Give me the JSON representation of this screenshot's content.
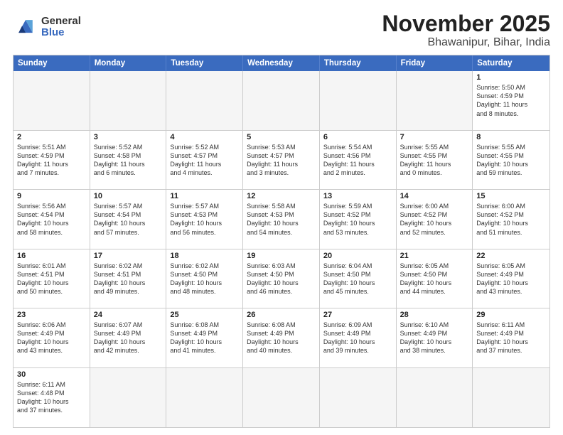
{
  "logo": {
    "line1": "General",
    "line2": "Blue"
  },
  "title": "November 2025",
  "subtitle": "Bhawanipur, Bihar, India",
  "header_days": [
    "Sunday",
    "Monday",
    "Tuesday",
    "Wednesday",
    "Thursday",
    "Friday",
    "Saturday"
  ],
  "weeks": [
    [
      {
        "day": "",
        "empty": true,
        "info": ""
      },
      {
        "day": "",
        "empty": true,
        "info": ""
      },
      {
        "day": "",
        "empty": true,
        "info": ""
      },
      {
        "day": "",
        "empty": true,
        "info": ""
      },
      {
        "day": "",
        "empty": true,
        "info": ""
      },
      {
        "day": "",
        "empty": true,
        "info": ""
      },
      {
        "day": "1",
        "empty": false,
        "info": "Sunrise: 5:50 AM\nSunset: 4:59 PM\nDaylight: 11 hours\nand 8 minutes."
      }
    ],
    [
      {
        "day": "2",
        "empty": false,
        "info": "Sunrise: 5:51 AM\nSunset: 4:59 PM\nDaylight: 11 hours\nand 7 minutes."
      },
      {
        "day": "3",
        "empty": false,
        "info": "Sunrise: 5:52 AM\nSunset: 4:58 PM\nDaylight: 11 hours\nand 6 minutes."
      },
      {
        "day": "4",
        "empty": false,
        "info": "Sunrise: 5:52 AM\nSunset: 4:57 PM\nDaylight: 11 hours\nand 4 minutes."
      },
      {
        "day": "5",
        "empty": false,
        "info": "Sunrise: 5:53 AM\nSunset: 4:57 PM\nDaylight: 11 hours\nand 3 minutes."
      },
      {
        "day": "6",
        "empty": false,
        "info": "Sunrise: 5:54 AM\nSunset: 4:56 PM\nDaylight: 11 hours\nand 2 minutes."
      },
      {
        "day": "7",
        "empty": false,
        "info": "Sunrise: 5:55 AM\nSunset: 4:55 PM\nDaylight: 11 hours\nand 0 minutes."
      },
      {
        "day": "8",
        "empty": false,
        "info": "Sunrise: 5:55 AM\nSunset: 4:55 PM\nDaylight: 10 hours\nand 59 minutes."
      }
    ],
    [
      {
        "day": "9",
        "empty": false,
        "info": "Sunrise: 5:56 AM\nSunset: 4:54 PM\nDaylight: 10 hours\nand 58 minutes."
      },
      {
        "day": "10",
        "empty": false,
        "info": "Sunrise: 5:57 AM\nSunset: 4:54 PM\nDaylight: 10 hours\nand 57 minutes."
      },
      {
        "day": "11",
        "empty": false,
        "info": "Sunrise: 5:57 AM\nSunset: 4:53 PM\nDaylight: 10 hours\nand 56 minutes."
      },
      {
        "day": "12",
        "empty": false,
        "info": "Sunrise: 5:58 AM\nSunset: 4:53 PM\nDaylight: 10 hours\nand 54 minutes."
      },
      {
        "day": "13",
        "empty": false,
        "info": "Sunrise: 5:59 AM\nSunset: 4:52 PM\nDaylight: 10 hours\nand 53 minutes."
      },
      {
        "day": "14",
        "empty": false,
        "info": "Sunrise: 6:00 AM\nSunset: 4:52 PM\nDaylight: 10 hours\nand 52 minutes."
      },
      {
        "day": "15",
        "empty": false,
        "info": "Sunrise: 6:00 AM\nSunset: 4:52 PM\nDaylight: 10 hours\nand 51 minutes."
      }
    ],
    [
      {
        "day": "16",
        "empty": false,
        "info": "Sunrise: 6:01 AM\nSunset: 4:51 PM\nDaylight: 10 hours\nand 50 minutes."
      },
      {
        "day": "17",
        "empty": false,
        "info": "Sunrise: 6:02 AM\nSunset: 4:51 PM\nDaylight: 10 hours\nand 49 minutes."
      },
      {
        "day": "18",
        "empty": false,
        "info": "Sunrise: 6:02 AM\nSunset: 4:50 PM\nDaylight: 10 hours\nand 48 minutes."
      },
      {
        "day": "19",
        "empty": false,
        "info": "Sunrise: 6:03 AM\nSunset: 4:50 PM\nDaylight: 10 hours\nand 46 minutes."
      },
      {
        "day": "20",
        "empty": false,
        "info": "Sunrise: 6:04 AM\nSunset: 4:50 PM\nDaylight: 10 hours\nand 45 minutes."
      },
      {
        "day": "21",
        "empty": false,
        "info": "Sunrise: 6:05 AM\nSunset: 4:50 PM\nDaylight: 10 hours\nand 44 minutes."
      },
      {
        "day": "22",
        "empty": false,
        "info": "Sunrise: 6:05 AM\nSunset: 4:49 PM\nDaylight: 10 hours\nand 43 minutes."
      }
    ],
    [
      {
        "day": "23",
        "empty": false,
        "info": "Sunrise: 6:06 AM\nSunset: 4:49 PM\nDaylight: 10 hours\nand 43 minutes."
      },
      {
        "day": "24",
        "empty": false,
        "info": "Sunrise: 6:07 AM\nSunset: 4:49 PM\nDaylight: 10 hours\nand 42 minutes."
      },
      {
        "day": "25",
        "empty": false,
        "info": "Sunrise: 6:08 AM\nSunset: 4:49 PM\nDaylight: 10 hours\nand 41 minutes."
      },
      {
        "day": "26",
        "empty": false,
        "info": "Sunrise: 6:08 AM\nSunset: 4:49 PM\nDaylight: 10 hours\nand 40 minutes."
      },
      {
        "day": "27",
        "empty": false,
        "info": "Sunrise: 6:09 AM\nSunset: 4:49 PM\nDaylight: 10 hours\nand 39 minutes."
      },
      {
        "day": "28",
        "empty": false,
        "info": "Sunrise: 6:10 AM\nSunset: 4:49 PM\nDaylight: 10 hours\nand 38 minutes."
      },
      {
        "day": "29",
        "empty": false,
        "info": "Sunrise: 6:11 AM\nSunset: 4:49 PM\nDaylight: 10 hours\nand 37 minutes."
      }
    ],
    [
      {
        "day": "30",
        "empty": false,
        "info": "Sunrise: 6:11 AM\nSunset: 4:48 PM\nDaylight: 10 hours\nand 37 minutes."
      },
      {
        "day": "",
        "empty": true,
        "info": ""
      },
      {
        "day": "",
        "empty": true,
        "info": ""
      },
      {
        "day": "",
        "empty": true,
        "info": ""
      },
      {
        "day": "",
        "empty": true,
        "info": ""
      },
      {
        "day": "",
        "empty": true,
        "info": ""
      },
      {
        "day": "",
        "empty": true,
        "info": ""
      }
    ]
  ]
}
